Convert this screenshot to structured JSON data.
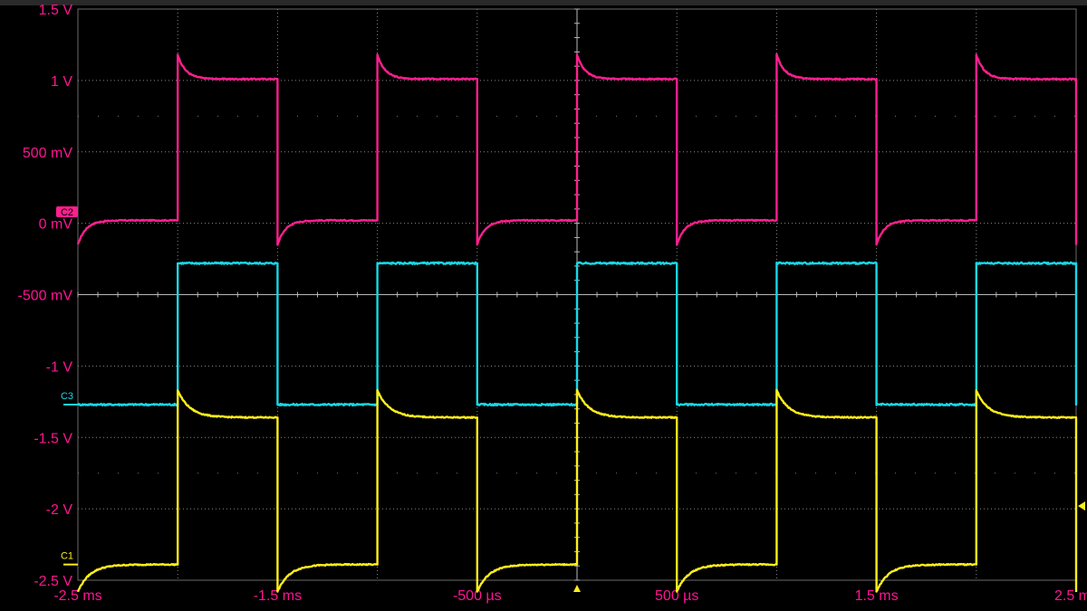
{
  "chart_data": {
    "type": "line",
    "title": "",
    "xlabel": "",
    "ylabel": "",
    "xlim": [
      -2.5,
      2.5
    ],
    "ylim": [
      -2.5,
      1.5
    ],
    "x_unit": "ms",
    "grid": true,
    "y_ticks": [
      {
        "value": 1.5,
        "label": "1.5 V"
      },
      {
        "value": 1.0,
        "label": "1 V"
      },
      {
        "value": 0.5,
        "label": "500 mV"
      },
      {
        "value": 0.0,
        "label": "0 mV"
      },
      {
        "value": -0.5,
        "label": "-500 mV"
      },
      {
        "value": -1.0,
        "label": "-1 V"
      },
      {
        "value": -1.5,
        "label": "-1.5 V"
      },
      {
        "value": -2.0,
        "label": "-2 V"
      },
      {
        "value": -2.5,
        "label": "-2.5 V"
      }
    ],
    "x_ticks": [
      {
        "value": -2.5,
        "label": "-2.5 ms"
      },
      {
        "value": -1.5,
        "label": "-1.5 ms"
      },
      {
        "value": -0.5,
        "label": "-500 µs"
      },
      {
        "value": 0.5,
        "label": "500 µs"
      },
      {
        "value": 1.5,
        "label": "1.5 ms"
      },
      {
        "value": 2.5,
        "label": "2.5 ms"
      }
    ],
    "period_ms": 1.0,
    "series": [
      {
        "name": "C2",
        "color": "#ff1f8e",
        "shape": "rc_square",
        "first_high_edge_ms": -2.0,
        "low_level_V": 0.02,
        "high_level_V": 1.01,
        "overshoot_V": 0.17,
        "tau_ms": 0.04,
        "marker_V": 0.08
      },
      {
        "name": "C3",
        "color": "#19d7e6",
        "shape": "square",
        "first_high_edge_ms": -2.0,
        "low_level_V": -1.27,
        "high_level_V": -0.28,
        "marker_V": -1.27
      },
      {
        "name": "C1",
        "color": "#ffee1a",
        "shape": "rc_square",
        "first_high_edge_ms": -2.0,
        "low_level_V": -2.39,
        "high_level_V": -1.36,
        "overshoot_V": 0.19,
        "tau_ms": 0.06,
        "marker_V": -2.39
      }
    ],
    "trigger": {
      "x_ms": 0.0,
      "y_V": -1.98,
      "color": "#ffee1a"
    }
  }
}
